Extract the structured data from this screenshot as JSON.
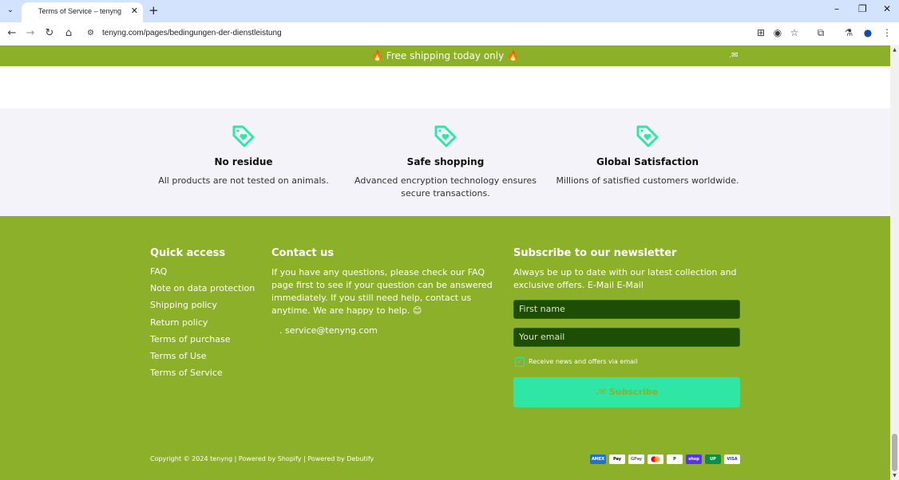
{
  "browser": {
    "tab_title": "Terms of Service – tenyng",
    "url": "tenyng.com/pages/bedingungen-der-dienstleistung"
  },
  "announcement": {
    "text": "🔥 Free shipping today only 🔥"
  },
  "features": [
    {
      "title": "No residue",
      "text": "All products are not tested on animals."
    },
    {
      "title": "Safe shopping",
      "text": "Advanced encryption technology ensures secure transactions."
    },
    {
      "title": "Global Satisfaction",
      "text": "Millions of satisfied customers worldwide."
    }
  ],
  "footer": {
    "quick_access": {
      "title": "Quick access",
      "links": [
        "FAQ",
        "Note on data protection",
        "Shipping policy",
        "Return policy",
        "Terms of purchase",
        "Terms of Use",
        "Terms of Service"
      ]
    },
    "contact": {
      "title": "Contact us",
      "text": "If you have any questions, please check our FAQ page first to see if your question can be answered immediately. If you still need help, contact us anytime. We are happy to help. 😊",
      "email": ". service@tenyng.com"
    },
    "newsletter": {
      "title": "Subscribe to our newsletter",
      "text": "Always be up to date with our latest collection and exclusive offers. E-Mail E-Mail",
      "first_name_placeholder": "First name",
      "email_placeholder": "Your email",
      "checkbox_label": "Receive news and offers via email",
      "submit_label": "Subscribe"
    },
    "copyright": "Copyright © 2024 tenyng | Powered by Shopify | Powered by Debutify",
    "payment_icons": [
      "amex-icon",
      "apple-pay-icon",
      "google-pay-icon",
      "mastercard-icon",
      "paypal-icon",
      "shop-pay-icon",
      "union-pay-icon",
      "visa-icon"
    ]
  },
  "colors": {
    "brand_green": "#8db02a",
    "accent_mint": "#2fe6a5",
    "input_dark_green": "#1e4d06"
  }
}
